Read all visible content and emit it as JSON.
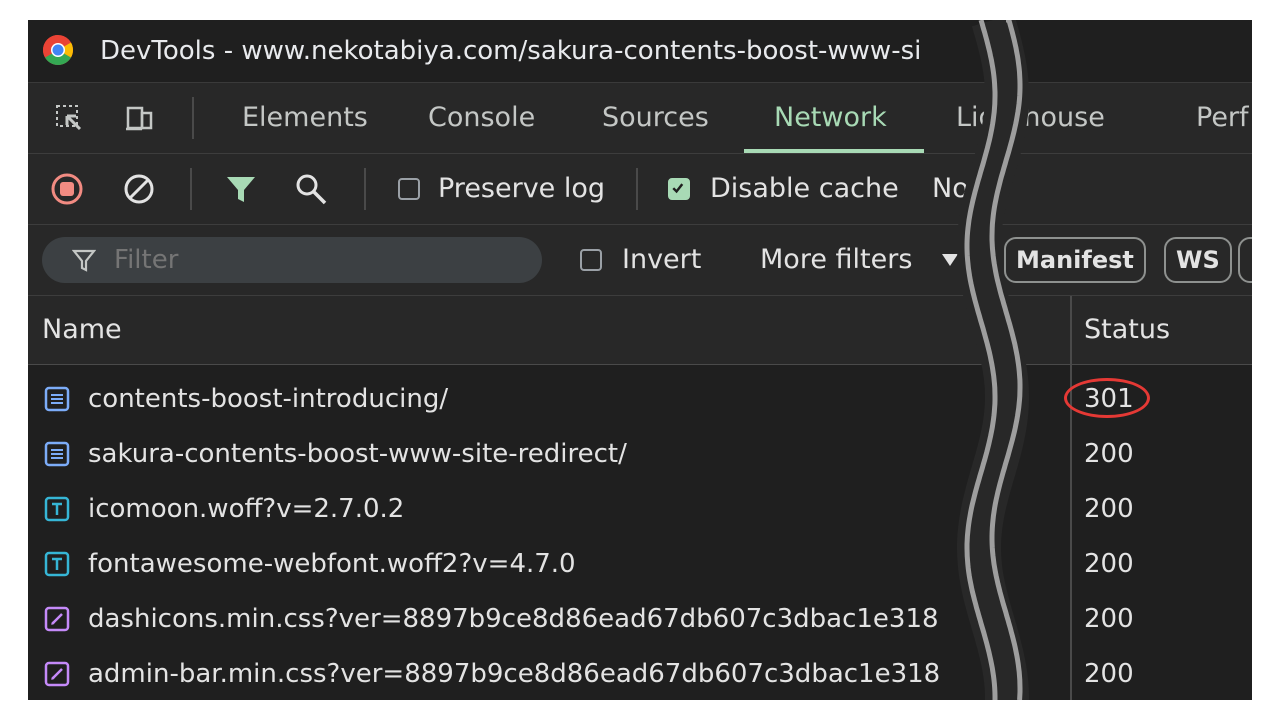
{
  "window": {
    "title": "DevTools - www.nekotabiya.com/sakura-contents-boost-www-si"
  },
  "main_tabs": [
    {
      "label": "Elements"
    },
    {
      "label": "Console"
    },
    {
      "label": "Sources"
    },
    {
      "label": "Network",
      "active": true
    },
    {
      "label": "Lighthouse"
    },
    {
      "label": "Perf"
    }
  ],
  "toolbar": {
    "preserve_log": {
      "label": "Preserve log",
      "checked": false
    },
    "disable_cache": {
      "label": "Disable cache",
      "checked": true
    },
    "throttling_label": "No t"
  },
  "filterbar": {
    "filter_placeholder": "Filter",
    "invert": {
      "label": "Invert",
      "checked": false
    },
    "more_filters_label": "More filters",
    "type_pills": [
      "Manifest",
      "WS"
    ]
  },
  "table": {
    "columns": [
      "Name",
      "Status"
    ],
    "rows": [
      {
        "name": "contents-boost-introducing/",
        "status": "301",
        "type": "document"
      },
      {
        "name": "sakura-contents-boost-www-site-redirect/",
        "status": "200",
        "type": "document"
      },
      {
        "name": "icomoon.woff?v=2.7.0.2",
        "status": "200",
        "type": "font"
      },
      {
        "name": "fontawesome-webfont.woff2?v=4.7.0",
        "status": "200",
        "type": "font"
      },
      {
        "name": "dashicons.min.css?ver=8897b9ce8d86ead67db607c3dbac1e318",
        "status": "200",
        "type": "stylesheet"
      },
      {
        "name": "admin-bar.min.css?ver=8897b9ce8d86ead67db607c3dbac1e318",
        "status": "200",
        "type": "stylesheet"
      }
    ]
  },
  "icons": {
    "app_logo": "chrome-logo-icon",
    "inspect": "inspect-element-icon",
    "device": "device-toolbar-icon",
    "record": "stop-recording-icon",
    "clear": "clear-icon",
    "filter": "filter-funnel-icon",
    "search": "search-icon",
    "document": "document-file-icon",
    "font": "font-file-icon",
    "stylesheet": "stylesheet-file-icon"
  },
  "colors": {
    "active_tab": "#a8dab5",
    "record_red": "#f28b82",
    "highlight_circle": "#e53935",
    "document_icon": "#7cacf8",
    "font_icon": "#36b6d6",
    "stylesheet_icon": "#c58af9"
  }
}
